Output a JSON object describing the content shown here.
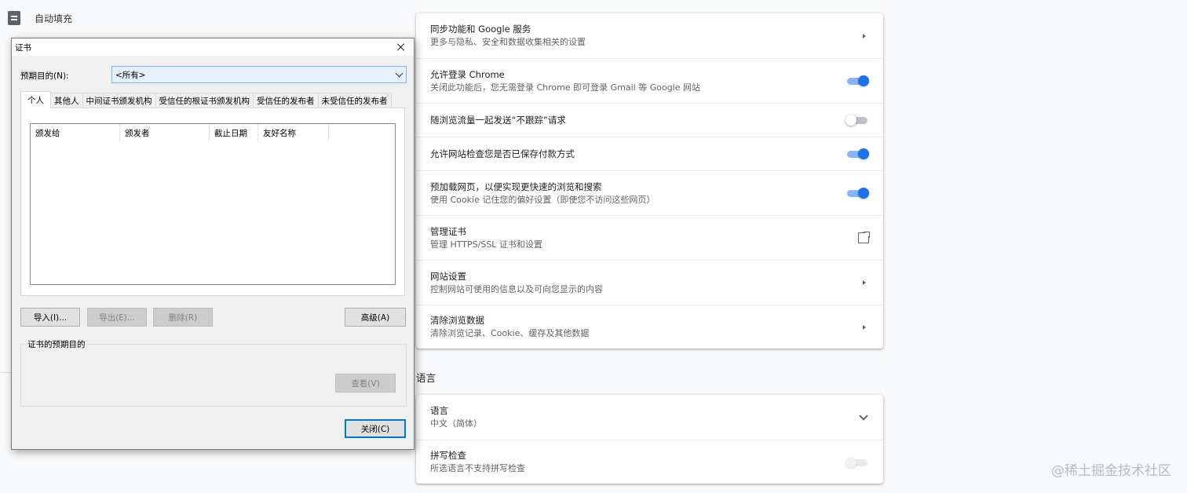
{
  "left_nav": {
    "autofill_label": "自动填充"
  },
  "privacy_card": {
    "rows": [
      {
        "primary": "同步功能和 Google 服务",
        "secondary": "更多与隐私、安全和数据收集相关的设置",
        "control": "chevron-right-icon"
      },
      {
        "primary": "允许登录 Chrome",
        "secondary": "关闭此功能后，您无需登录 Chrome 即可登录 Gmail 等 Google 网站",
        "control": "toggle",
        "toggle_state": "on"
      },
      {
        "primary": "随浏览流量一起发送“不跟踪”请求",
        "control": "toggle",
        "toggle_state": "off"
      },
      {
        "primary": "允许网站检查您是否已保存付款方式",
        "control": "toggle",
        "toggle_state": "on"
      },
      {
        "primary": "预加载网页，以便实现更快速的浏览和搜索",
        "secondary": "使用 Cookie 记住您的偏好设置（即使您不访问这些网页）",
        "control": "toggle",
        "toggle_state": "on"
      },
      {
        "primary": "管理证书",
        "secondary": "管理 HTTPS/SSL 证书和设置",
        "control": "open-in-new-icon"
      },
      {
        "primary": "网站设置",
        "secondary": "控制网站可使用的信息以及可向您显示的内容",
        "control": "chevron-right-icon"
      },
      {
        "primary": "清除浏览数据",
        "secondary": "清除浏览记录、Cookie、缓存及其他数据",
        "control": "chevron-right-icon"
      }
    ]
  },
  "language_section": {
    "title": "语言",
    "rows": [
      {
        "primary": "语言",
        "secondary": "中文（简体）",
        "control": "chevron-down-icon"
      },
      {
        "primary": "拼写检查",
        "secondary": "所选语言不支持拼写检查",
        "control": "toggle",
        "toggle_state": "disabled"
      }
    ]
  },
  "dialog": {
    "title": "证书",
    "purpose_label": "预期目的(N):",
    "purpose_value": "<所有>",
    "tabs": [
      "个人",
      "其他人",
      "中间证书颁发机构",
      "受信任的根证书颁发机构",
      "受信任的发布者",
      "未受信任的发布者"
    ],
    "active_tab": "个人",
    "columns": [
      "颁发给",
      "颁发者",
      "截止日期",
      "友好名称"
    ],
    "buttons": {
      "import": "导入(I)...",
      "export": "导出(E)...",
      "remove": "删除(R)",
      "advanced": "高级(A)",
      "view": "查看(V)",
      "close": "关闭(C)"
    },
    "purposes_group_label": "证书的预期目的"
  },
  "watermark": "@稀土掘金技术社区",
  "colors": {
    "accent": "#1a73e8",
    "toggle_track_on": "#8ab4f8",
    "dialog_bg": "#f0f0f0",
    "select_highlight": "#e5f1fb"
  }
}
